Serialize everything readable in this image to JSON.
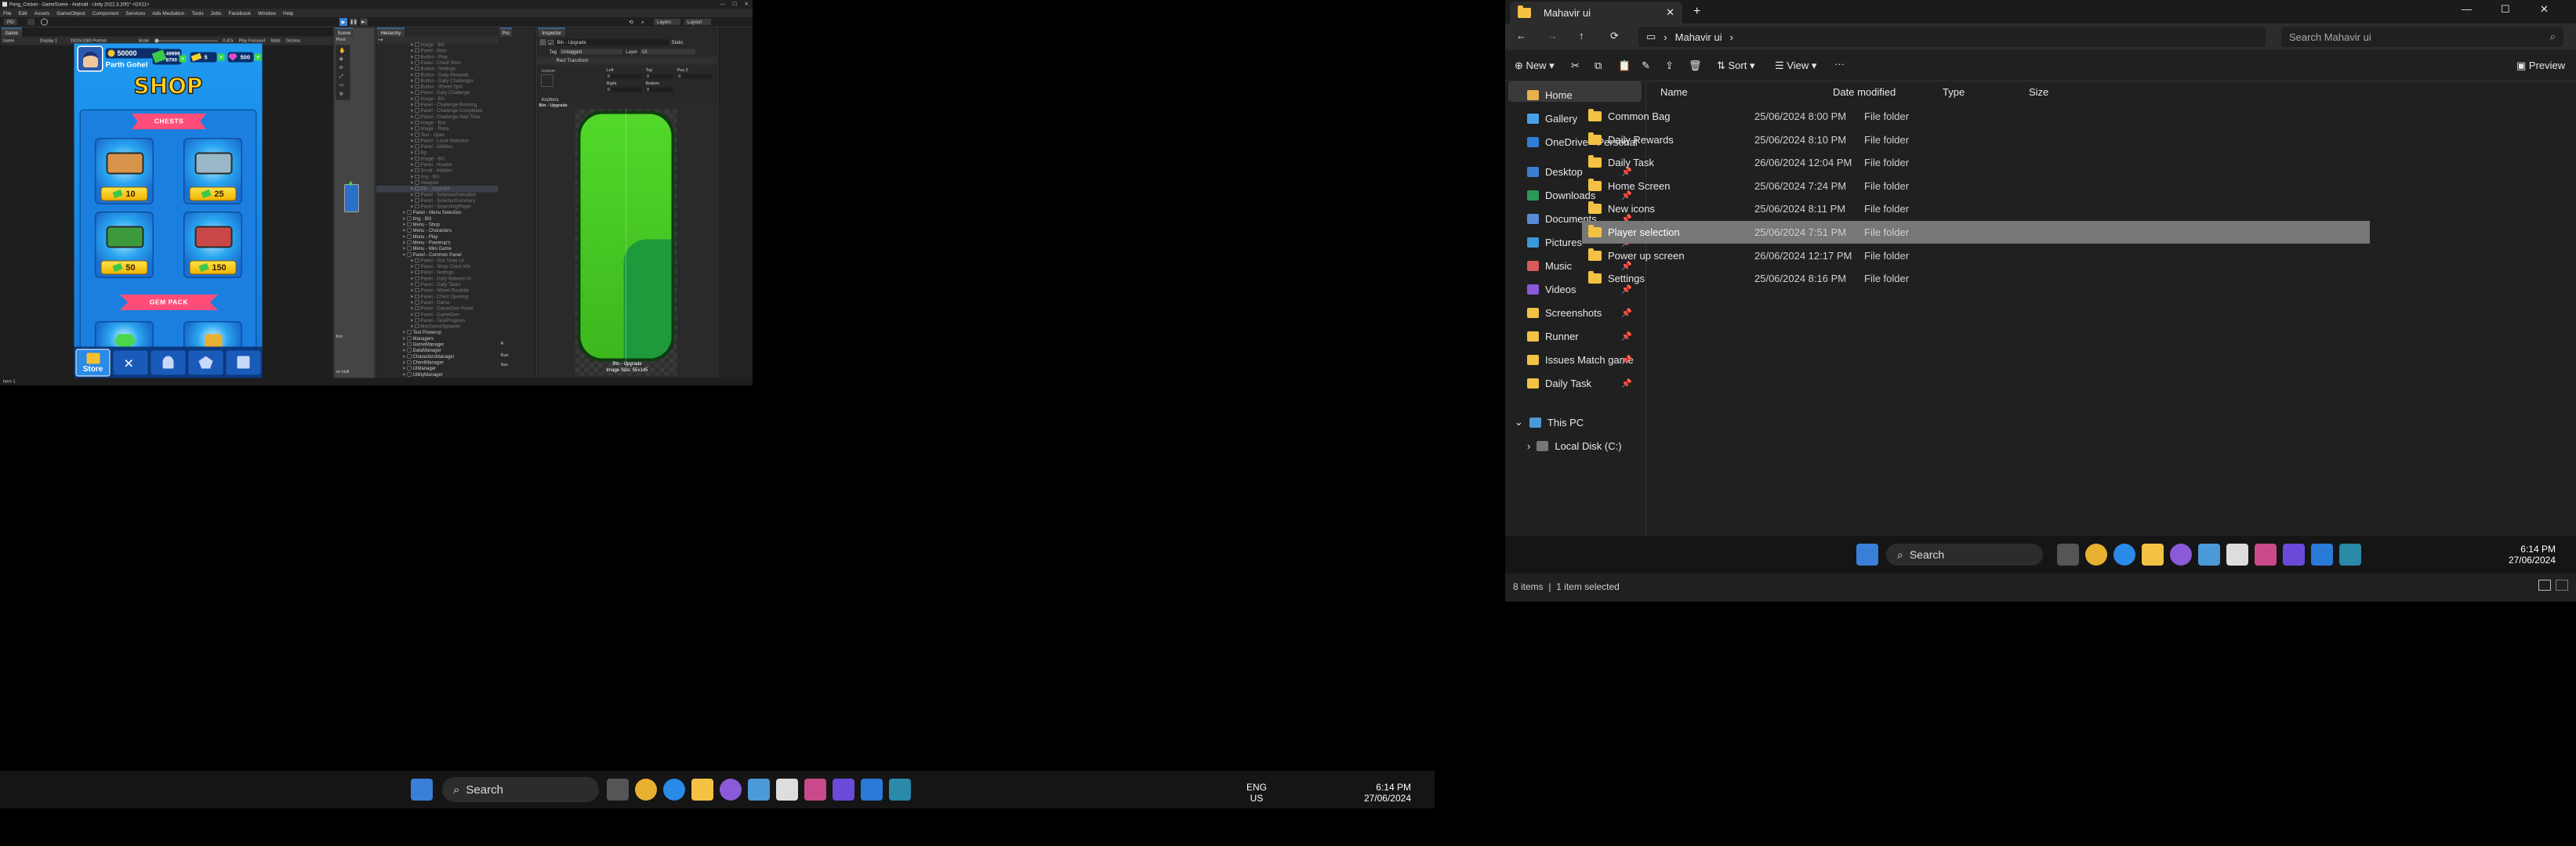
{
  "unity": {
    "title": "Pong_Cricket - GameScene - Android - Unity 2022.3.20f1* <DX11>",
    "menu": [
      "File",
      "Edit",
      "Assets",
      "GameObject",
      "Component",
      "Services",
      "Ads Mediation",
      "Tools",
      "Jobs",
      "Facebook",
      "Window",
      "Help"
    ],
    "toolbar": {
      "account": "PG",
      "layers": "Layers",
      "layout": "Layout"
    },
    "game": {
      "tab": "Game",
      "mode": "Game",
      "display": "Display 1",
      "resolution": "1920x1080 Portrait",
      "scale_label": "Scale",
      "scale_value": "0.47x",
      "play_mode": "Play Focused",
      "stats": "Stats",
      "gizmos": "Gizmos"
    },
    "scene": {
      "tab": "Scene",
      "pivot": "Pivot",
      "frag1": "tion",
      "frag2": "ve Hull"
    },
    "hierarchy": {
      "tab": "Hierarchy",
      "rows": [
        {
          "t": "Image - BG",
          "d": 0
        },
        {
          "t": "Panel - Main",
          "d": 0
        },
        {
          "t": "Button - Play",
          "d": 0
        },
        {
          "t": "Panel - Chest Slots",
          "d": 0
        },
        {
          "t": "Button - Settings",
          "d": 0
        },
        {
          "t": "Button - Daily Rewards",
          "d": 0
        },
        {
          "t": "Button - Daily Challenges",
          "d": 0
        },
        {
          "t": "Button - Wheel Spin",
          "d": 0
        },
        {
          "t": "Panel - Daily Challenge",
          "d": 0
        },
        {
          "t": "Image - BG",
          "d": 0
        },
        {
          "t": "Panel - Challenge Running",
          "d": 0
        },
        {
          "t": "Panel - Challenge Completed",
          "d": 0
        },
        {
          "t": "Panel - Challenge Wait Time",
          "d": 0
        },
        {
          "t": "Image - Box",
          "d": 0
        },
        {
          "t": "Image - Rune",
          "d": 0
        },
        {
          "t": "Text - Open",
          "d": 0
        },
        {
          "t": "Panel - Local Selection",
          "d": 0
        },
        {
          "t": "Panel - Abilities",
          "d": 0
        },
        {
          "t": "Bg",
          "d": 0
        },
        {
          "t": "Image - BG",
          "d": 0
        },
        {
          "t": "Panel - Header",
          "d": 0
        },
        {
          "t": "Scroll - Abilities",
          "d": 0
        },
        {
          "t": "Img - BG",
          "d": 0
        },
        {
          "t": "Viewport",
          "d": 0
        },
        {
          "t": "Btn - Upgrade",
          "d": 0,
          "sel": true
        },
        {
          "t": "Panel - SelectedAnimation",
          "d": 0
        },
        {
          "t": "Panel - SelectedSummary",
          "d": 0
        },
        {
          "t": "Panel - SearchingPlayer",
          "d": 0
        },
        {
          "t": "Panel - Menu Selection",
          "d": 1
        },
        {
          "t": "Img - BG",
          "d": 1
        },
        {
          "t": "Menu - Shop",
          "d": 1
        },
        {
          "t": "Menu - Characters",
          "d": 1
        },
        {
          "t": "Menu - Play",
          "d": 1
        },
        {
          "t": "Menu - Powerup's",
          "d": 1
        },
        {
          "t": "Menu - Mini Game",
          "d": 1
        },
        {
          "t": "Panel - Common Panel",
          "d": 1
        },
        {
          "t": "Panel - Slot Timer UI",
          "d": 0
        },
        {
          "t": "Panel - Shop Chest Info",
          "d": 0
        },
        {
          "t": "Panel - Settings",
          "d": 0
        },
        {
          "t": "Panel - Daily Reward UI",
          "d": 0
        },
        {
          "t": "Panel - Daily Tasks",
          "d": 0
        },
        {
          "t": "Panel - Wheel Roulette",
          "d": 0
        },
        {
          "t": "Panel - Chest Opening",
          "d": 0
        },
        {
          "t": "Panel - Game",
          "d": 0
        },
        {
          "t": "Panel - GameOver Panel",
          "d": 0
        },
        {
          "t": "Panel - GameOver",
          "d": 0
        },
        {
          "t": "Panel - TaskProgress",
          "d": 0
        },
        {
          "t": "MiniGameSpawner",
          "d": 0
        },
        {
          "t": "Test Powerup",
          "d": 1
        },
        {
          "t": "Managers",
          "d": 1
        },
        {
          "t": "GameManager",
          "d": 1
        },
        {
          "t": "DataManager",
          "d": 1
        },
        {
          "t": "CharactersManager",
          "d": 1
        },
        {
          "t": "ChestManager",
          "d": 1
        },
        {
          "t": "UIManager",
          "d": 1
        },
        {
          "t": "UtilityManager",
          "d": 1
        }
      ]
    },
    "project": {
      "tab": "Pro",
      "items": [
        "R",
        "Run",
        "Sav"
      ]
    },
    "inspector": {
      "tab": "Inspector",
      "name": "Btn - Upgrade",
      "static": "Static",
      "tag_label": "Tag",
      "tag": "Untagged",
      "layer_label": "Layer",
      "layer": "UI",
      "rect_transform": "Rect Transform",
      "custom": "custom",
      "left": "Left",
      "top": "Top",
      "posz": "Pos Z",
      "right": "Right",
      "bottom": "Bottom",
      "v0": "0",
      "anchors": "Anchors",
      "preview_name": "Btn - Upgrade",
      "preview_title": "Btn - Upgrade",
      "image_size": "Image Size: 55x145"
    },
    "status": "here 1"
  },
  "shop": {
    "player": "Parth Gohel",
    "coins": "50000",
    "cash_top": "49999",
    "cash_bottom": "8700",
    "tickets": "5",
    "gems": "500",
    "title": "SHOP",
    "section1": "CHESTS",
    "section2": "GEM PACK",
    "chests": [
      {
        "price": "10",
        "color": "#d8944a"
      },
      {
        "price": "25",
        "color": "#9ab8c8"
      },
      {
        "price": "50",
        "color": "#3c9a3c"
      },
      {
        "price": "150",
        "color": "#c84848"
      }
    ],
    "nav": [
      "Store",
      "",
      "",
      "",
      ""
    ]
  },
  "explorer": {
    "tab_title": "Mahavir ui",
    "address": "Mahavir ui",
    "search_placeholder": "Search Mahavir ui",
    "cmd": {
      "new": "New",
      "sort": "Sort",
      "view": "View",
      "preview": "Preview"
    },
    "columns": [
      "Name",
      "Date modified",
      "Type",
      "Size"
    ],
    "files": [
      {
        "name": "Common Bag",
        "date": "25/06/2024 8:00 PM",
        "type": "File folder"
      },
      {
        "name": "Daily Rewards",
        "date": "25/06/2024 8:10 PM",
        "type": "File folder"
      },
      {
        "name": "Daily Task",
        "date": "26/06/2024 12:04 PM",
        "type": "File folder"
      },
      {
        "name": "Home Screen",
        "date": "25/06/2024 7:24 PM",
        "type": "File folder"
      },
      {
        "name": "New icons",
        "date": "25/06/2024 8:11 PM",
        "type": "File folder"
      },
      {
        "name": "Player selection",
        "date": "25/06/2024 7:51 PM",
        "type": "File folder",
        "selected": true
      },
      {
        "name": "Power up screen",
        "date": "26/06/2024 12:17 PM",
        "type": "File folder"
      },
      {
        "name": "Settings",
        "date": "25/06/2024 8:16 PM",
        "type": "File folder"
      }
    ],
    "nav": [
      {
        "label": "Home",
        "color": "#e8b04a",
        "pin": false
      },
      {
        "label": "Gallery",
        "color": "#4aa0e8",
        "pin": false
      },
      {
        "label": "OneDrive - Personal",
        "color": "#2f7fd8",
        "pin": false
      },
      {
        "label": "Desktop",
        "color": "#3a7fd0",
        "pin": true
      },
      {
        "label": "Downloads",
        "color": "#2a9a5a",
        "pin": true
      },
      {
        "label": "Documents",
        "color": "#5a8ad8",
        "pin": true
      },
      {
        "label": "Pictures",
        "color": "#3a9ad8",
        "pin": true
      },
      {
        "label": "Music",
        "color": "#d85a5a",
        "pin": true
      },
      {
        "label": "Videos",
        "color": "#8a5ad8",
        "pin": true
      },
      {
        "label": "Screenshots",
        "color": "#f3c244",
        "pin": true
      },
      {
        "label": "Runner",
        "color": "#f3c244",
        "pin": true
      },
      {
        "label": "Issues Match game",
        "color": "#f3c244",
        "pin": true
      },
      {
        "label": "Daily Task",
        "color": "#f3c244",
        "pin": true
      }
    ],
    "this_pc": "This PC",
    "local_disk": "Local Disk (C:)",
    "status_items": "8 items",
    "status_sel": "1 item selected"
  },
  "taskbar": {
    "search": "Search",
    "lang": "ENG",
    "region": "US",
    "time": "6:14 PM",
    "date": "27/06/2024"
  }
}
